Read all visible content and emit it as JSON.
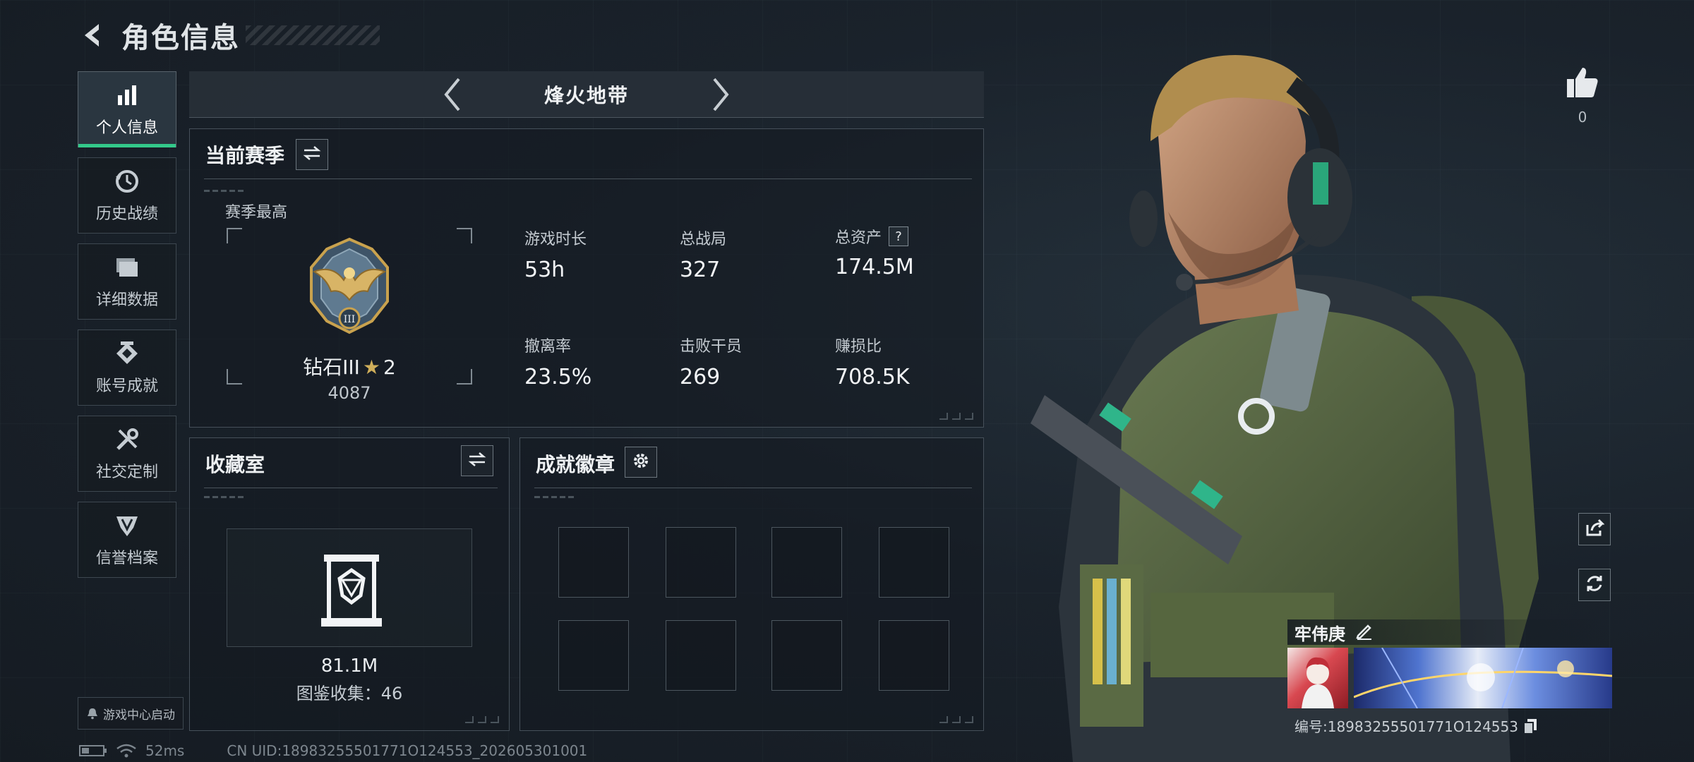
{
  "header": {
    "title": "角色信息",
    "back_icon": "back-arrow-icon"
  },
  "sidebar": {
    "items": [
      {
        "label": "个人信息",
        "icon": "bar-chart-icon",
        "active": true
      },
      {
        "label": "历史战绩",
        "icon": "history-clock-icon",
        "active": false
      },
      {
        "label": "详细数据",
        "icon": "folder-icon",
        "active": false
      },
      {
        "label": "账号成就",
        "icon": "achievement-icon",
        "active": false
      },
      {
        "label": "社交定制",
        "icon": "tools-icon",
        "active": false
      },
      {
        "label": "信誉档案",
        "icon": "shield-icon",
        "active": false
      }
    ],
    "launch_button": "游戏中心启动"
  },
  "status_bar": {
    "ping": "52ms",
    "uid": "CN UID:18983255501771O124553_202605301001"
  },
  "mode_selector": {
    "current": "烽火地带"
  },
  "season": {
    "title": "当前赛季",
    "subtitle": "赛季最高",
    "rank_name": "钻石III",
    "rank_stars": "2",
    "rank_score": "4087",
    "stats": [
      {
        "label": "游戏时长",
        "value": "53h"
      },
      {
        "label": "总战局",
        "value": "327"
      },
      {
        "label": "总资产",
        "value": "174.5M",
        "help": "?"
      },
      {
        "label": "撤离率",
        "value": "23.5%"
      },
      {
        "label": "击败干员",
        "value": "269"
      },
      {
        "label": "赚损比",
        "value": "708.5K"
      }
    ]
  },
  "collection": {
    "title": "收藏室",
    "value": "81.1M",
    "catalog": "图鉴收集：46"
  },
  "badges": {
    "title": "成就徽章",
    "slots": 8
  },
  "profile": {
    "likes": "0",
    "player_name": "牢伟庚",
    "player_id": "编号:18983255501771O124553"
  },
  "colors": {
    "accent": "#33c98a",
    "panel_border": "#46505a",
    "text": "#e4e8ec"
  }
}
